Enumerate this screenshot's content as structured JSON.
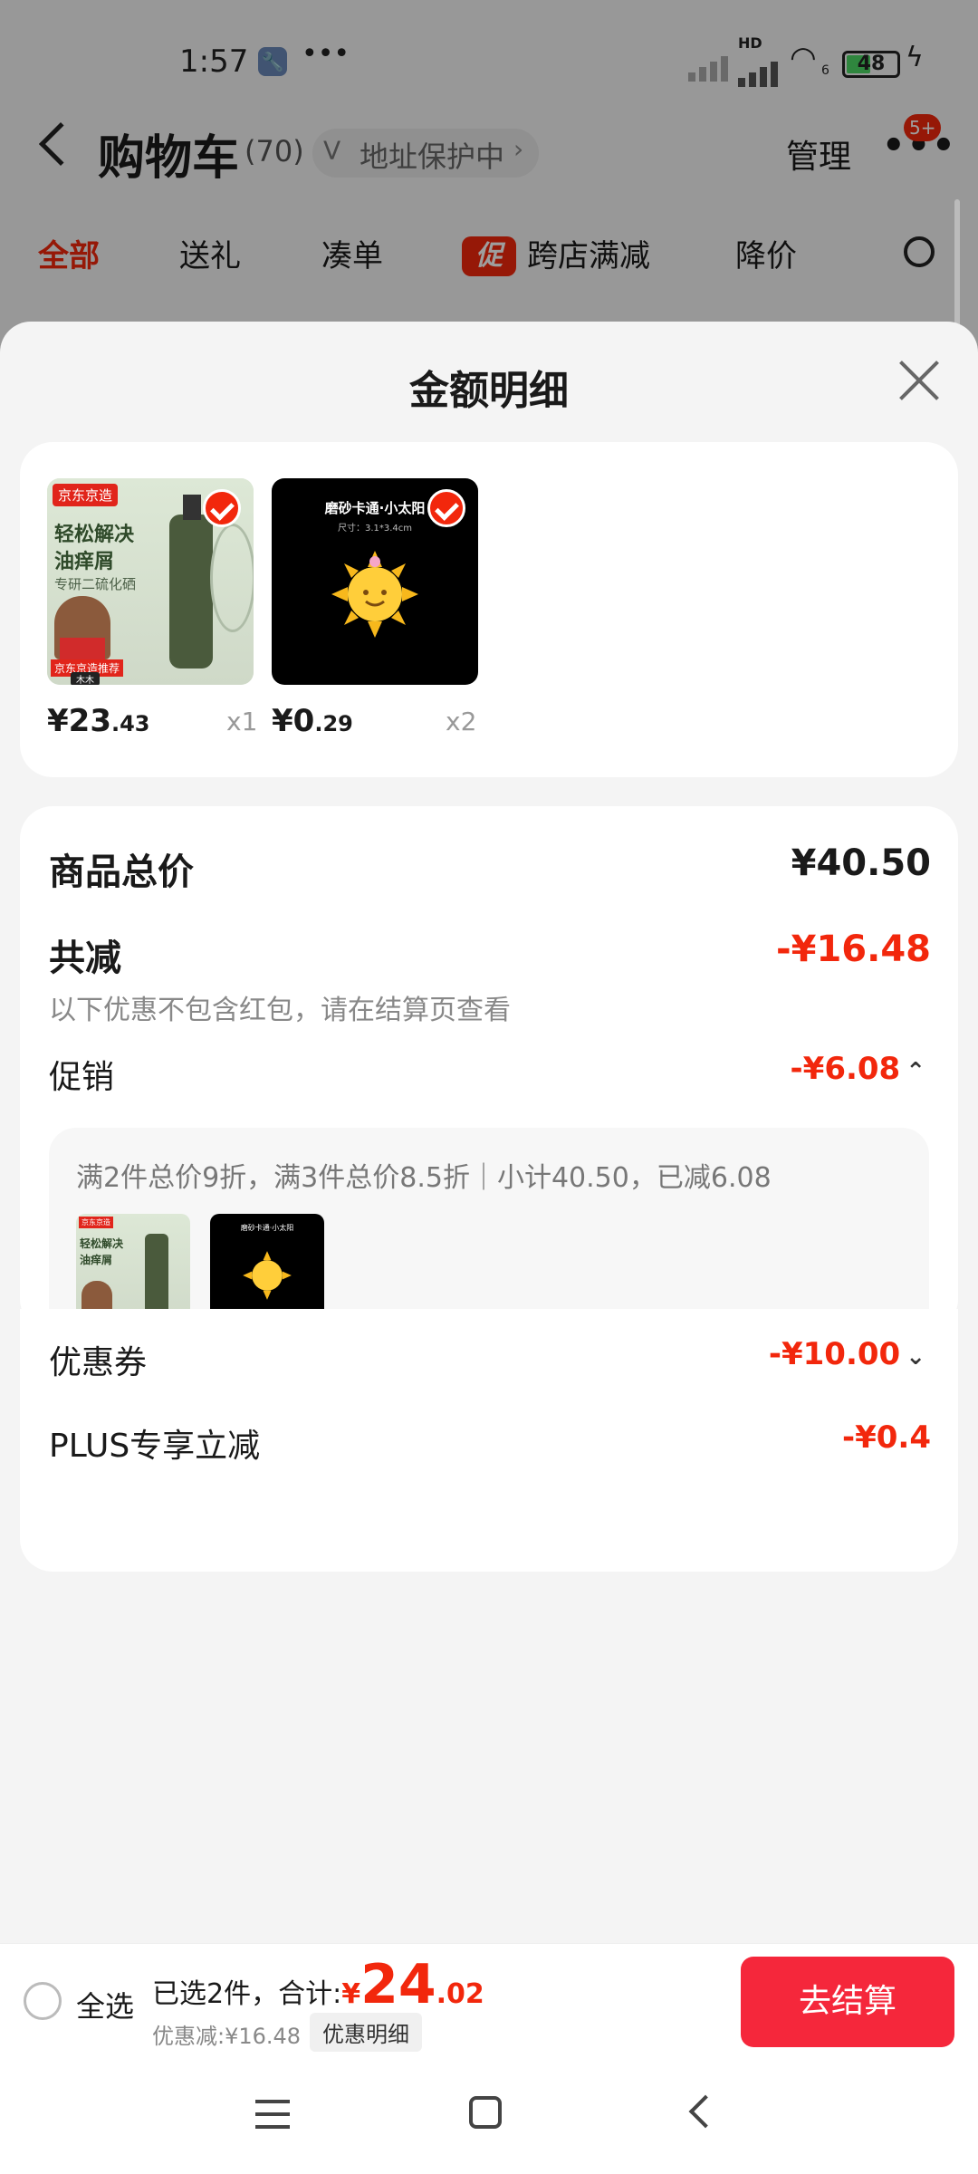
{
  "status_bar": {
    "time": "1:57",
    "dots": "•••",
    "battery": "48",
    "battery_level": 0.48,
    "network_hd": "HD",
    "wifi_sub": "6"
  },
  "header": {
    "back_icon": "chevron-left-icon",
    "title": "购物车",
    "count": "(70)",
    "address_tag": "地址保护中",
    "manage": "管理",
    "badge": "5+"
  },
  "tabs": [
    {
      "label": "全部",
      "active": true
    },
    {
      "label": "送礼"
    },
    {
      "label": "凑单"
    },
    {
      "promo_mark": "促",
      "label": "跨店满减"
    },
    {
      "label": "降价"
    }
  ],
  "sheet": {
    "title": "金额明细"
  },
  "items": [
    {
      "price_main": "¥23",
      "price_cents": ".43",
      "qty": "x1",
      "thumb": {
        "brand": "京东京造",
        "line1": "轻松解决",
        "line2": "油痒屑",
        "line3": "专研二硫化硒",
        "banner": "京东京造推荐",
        "name": "木木"
      }
    },
    {
      "price_main": "¥0",
      "price_cents": ".29",
      "qty": "x2",
      "thumb": {
        "line1": "磨砂卡通·小太阳",
        "line2": "尺寸：3.1*3.4cm"
      }
    }
  ],
  "summary": {
    "total_label": "商品总价",
    "total_value": "¥40.50",
    "discount_label": "共减",
    "discount_value": "-¥16.48",
    "discount_note": "以下优惠不包含红包，请在结算页查看",
    "promo_label": "促销",
    "promo_value": "-¥6.08",
    "promo_detail": "满2件总价9折，满3件总价8.5折｜小计40.50，已减6.08",
    "coupon_label": "优惠券",
    "coupon_value": "-¥10.00",
    "plus_label": "PLUS专享立减",
    "plus_value": "-¥0.4"
  },
  "bottom": {
    "select_all": "全选",
    "selected_text": "已选2件，合计:",
    "currency": "¥",
    "total_main": "24",
    "total_cents": ".02",
    "saved_text": "优惠减:¥16.48",
    "detail_button": "优惠明细",
    "checkout": "去结算"
  },
  "colors": {
    "accent": "#f2270c",
    "checkout_bg": "#f5273b"
  }
}
